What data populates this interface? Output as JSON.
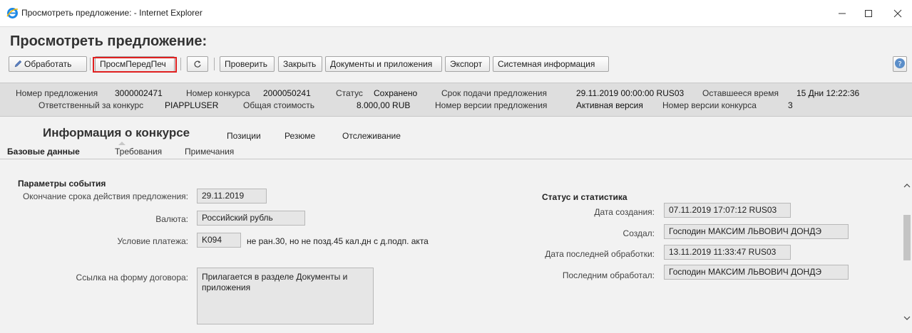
{
  "window": {
    "title": "Просмотреть предложение: - Internet Explorer",
    "controls": [
      "minimize-icon",
      "maximize-icon",
      "close-icon"
    ]
  },
  "page": {
    "title": "Просмотреть предложение:"
  },
  "toolbar": {
    "edit_label": "Обработать",
    "print_preview_label": "ПросмПередПеч",
    "refresh_icon": "refresh-icon",
    "check_label": "Проверить",
    "close_label": "Закрыть",
    "docs_label": "Документы и приложения",
    "export_label": "Экспорт",
    "sysinfo_label": "Системная информация",
    "help_icon": "help-icon"
  },
  "info": {
    "offer_number_label": "Номер предложения",
    "offer_number": "3000002471",
    "tender_number_label": "Номер конкурса",
    "tender_number": "2000050241",
    "status_label": "Статус",
    "status": "Сохранено",
    "deadline_label": "Срок подачи предложения",
    "deadline": "29.11.2019 00:00:00 RUS03",
    "remaining_label": "Оставшееся время",
    "remaining": "15 Дни 12:22:36",
    "responsible_label": "Ответственный за конкурс",
    "responsible": "PIAPPLUSER",
    "total_cost_label": "Общая стоимость",
    "total_cost": "8.000,00 RUB",
    "offer_version_label": "Номер версии предложения",
    "offer_version": "Активная версия",
    "tender_version_label": "Номер версии конкурса",
    "tender_version": "3"
  },
  "tabs": {
    "main": [
      "Информация о конкурсе",
      "Позиции",
      "Резюме",
      "Отслеживание"
    ],
    "sub": [
      "Базовые данные",
      "Требования",
      "Примечания"
    ]
  },
  "event_params": {
    "title": "Параметры события",
    "validity_end_label": "Окончание срока действия предложения:",
    "validity_end": "29.11.2019",
    "currency_label": "Валюта:",
    "currency": "Российский рубль",
    "payment_terms_label": "Условие платежа:",
    "payment_terms_code": "K094",
    "payment_terms_text": "не ран.30, но не позд.45 кал.дн с д.подп. акта",
    "contract_link_label": "Ссылка на форму договора:",
    "contract_link": "Прилагается в разделе Документы и приложения"
  },
  "status_stats": {
    "title": "Статус и статистика",
    "created_date_label": "Дата создания:",
    "created_date": "07.11.2019 17:07:12 RUS03",
    "created_by_label": "Создал:",
    "created_by": "Господин МАКСИМ ЛЬВОВИЧ ДОНДЭ",
    "last_edit_date_label": "Дата последней обработки:",
    "last_edit_date": "13.11.2019 11:33:47 RUS03",
    "last_edited_by_label": "Последним обработал:",
    "last_edited_by": "Господин МАКСИМ ЛЬВОВИЧ ДОНДЭ"
  },
  "colors": {
    "highlight": "#e02020",
    "ie_blue": "#1e88e5",
    "info_bg": "#dedede"
  }
}
